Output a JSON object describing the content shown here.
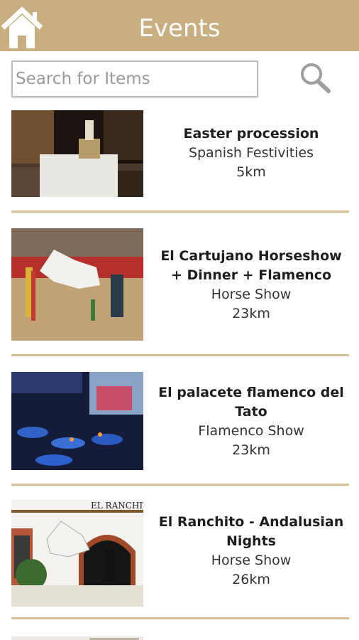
{
  "header": {
    "title": "Events",
    "home_icon": "home-icon",
    "background": "#c8ae80"
  },
  "search": {
    "placeholder": "Search for Items",
    "value": "",
    "icon": "search-icon"
  },
  "events": [
    {
      "name": "Easter procession",
      "category": "Spanish Festivities",
      "distance": "5km"
    },
    {
      "name": "El Cartujano Horseshow + Dinner + Flamenco",
      "category": "Horse Show",
      "distance": "23km"
    },
    {
      "name": "El palacete flamenco del Tato",
      "category": "Flamenco Show",
      "distance": "23km"
    },
    {
      "name": "El Ranchito - Andalusian Nights",
      "category": "Horse Show",
      "distance": "26km"
    }
  ],
  "image_text": {
    "ranchito_sign": "EL RANCHITO"
  },
  "colors": {
    "accent": "#c8ae80",
    "divider": "#d6bf92"
  }
}
